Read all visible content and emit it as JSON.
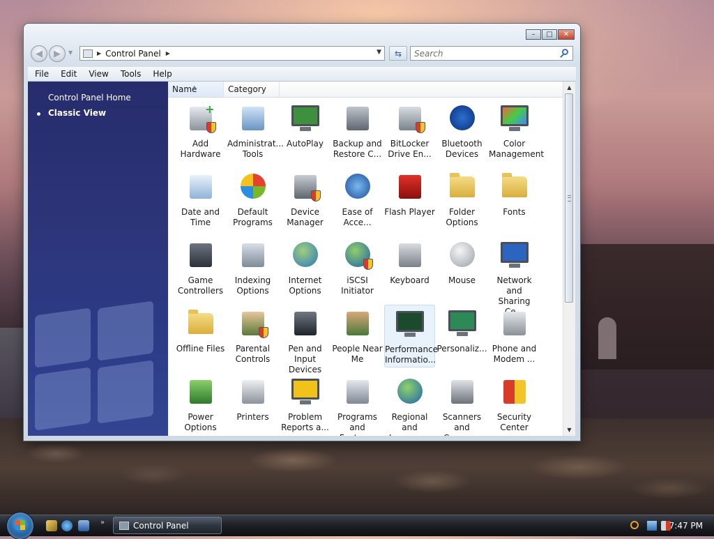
{
  "window": {
    "address_path": "Control Panel",
    "search_placeholder": "Search",
    "caption": {
      "minimize": "–",
      "maximize": "□",
      "close": "✕"
    }
  },
  "menubar": [
    "File",
    "Edit",
    "View",
    "Tools",
    "Help"
  ],
  "sidebar": {
    "home_label": "Control Panel Home",
    "classic_label": "Classic View"
  },
  "columns": {
    "name": "Name",
    "category": "Category"
  },
  "items": [
    {
      "label": "Add\nHardware",
      "icon": "add-hardware-icon"
    },
    {
      "label": "Administrat...\nTools",
      "icon": "administrative-tools-icon"
    },
    {
      "label": "AutoPlay",
      "icon": "autoplay-icon"
    },
    {
      "label": "Backup and\nRestore C...",
      "icon": "backup-restore-icon"
    },
    {
      "label": "BitLocker\nDrive En...",
      "icon": "bitlocker-icon"
    },
    {
      "label": "Bluetooth\nDevices",
      "icon": "bluetooth-icon"
    },
    {
      "label": "Color\nManagement",
      "icon": "color-management-icon"
    },
    {
      "label": "Date and\nTime",
      "icon": "date-time-icon"
    },
    {
      "label": "Default\nPrograms",
      "icon": "default-programs-icon"
    },
    {
      "label": "Device\nManager",
      "icon": "device-manager-icon"
    },
    {
      "label": "Ease of\nAcce...",
      "icon": "ease-of-access-icon"
    },
    {
      "label": "Flash Player",
      "icon": "flash-player-icon"
    },
    {
      "label": "Folder\nOptions",
      "icon": "folder-options-icon"
    },
    {
      "label": "Fonts",
      "icon": "fonts-icon"
    },
    {
      "label": "Game\nControllers",
      "icon": "game-controllers-icon"
    },
    {
      "label": "Indexing\nOptions",
      "icon": "indexing-options-icon"
    },
    {
      "label": "Internet\nOptions",
      "icon": "internet-options-icon"
    },
    {
      "label": "iSCSI Initiator",
      "icon": "iscsi-initiator-icon"
    },
    {
      "label": "Keyboard",
      "icon": "keyboard-icon"
    },
    {
      "label": "Mouse",
      "icon": "mouse-icon"
    },
    {
      "label": "Network and\nSharing Ce...",
      "icon": "network-sharing-icon"
    },
    {
      "label": "Offline Files",
      "icon": "offline-files-icon"
    },
    {
      "label": "Parental\nControls",
      "icon": "parental-controls-icon"
    },
    {
      "label": "Pen and\nInput Devices",
      "icon": "pen-input-icon"
    },
    {
      "label": "People Near\nMe",
      "icon": "people-near-me-icon"
    },
    {
      "label": "Performance\nInformatio...",
      "icon": "performance-icon",
      "selected": true
    },
    {
      "label": "Personaliz...",
      "icon": "personalization-icon"
    },
    {
      "label": "Phone and\nModem ...",
      "icon": "phone-modem-icon"
    },
    {
      "label": "Power\nOptions",
      "icon": "power-options-icon"
    },
    {
      "label": "Printers",
      "icon": "printers-icon"
    },
    {
      "label": "Problem\nReports a...",
      "icon": "problem-reports-icon"
    },
    {
      "label": "Programs\nand Features",
      "icon": "programs-features-icon"
    },
    {
      "label": "Regional and\nLanguage ...",
      "icon": "regional-language-icon"
    },
    {
      "label": "Scanners and\nCameras",
      "icon": "scanners-cameras-icon"
    },
    {
      "label": "Security\nCenter",
      "icon": "security-center-icon"
    }
  ],
  "taskbar": {
    "task_label": "Control Panel",
    "clock": "7:47 PM"
  },
  "colors": {
    "sidebar": "#2b3478",
    "selection": "#e0eefa",
    "accent": "#3f6fb5"
  }
}
